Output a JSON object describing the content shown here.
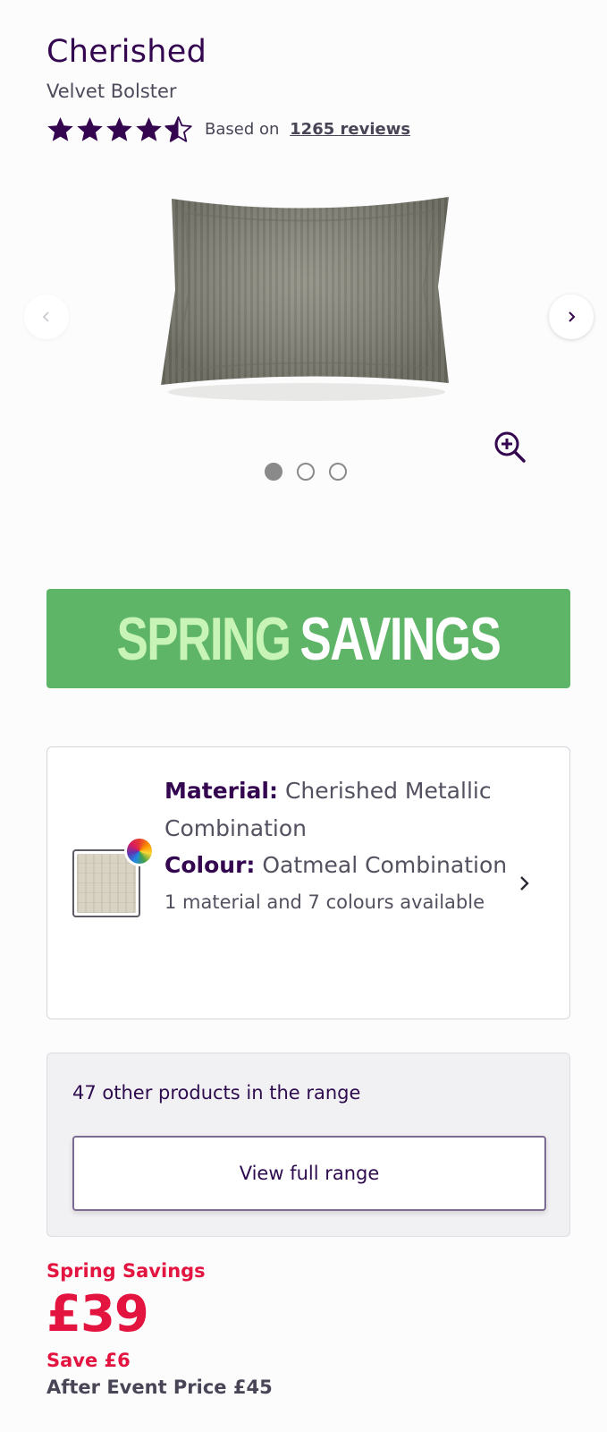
{
  "product": {
    "brand": "Cherished",
    "name": "Velvet Bolster"
  },
  "rating": {
    "stars": 4.5,
    "max_stars": 5,
    "prefix": "Based on",
    "reviews_link": "1265 reviews"
  },
  "gallery": {
    "image_count": 3,
    "active_index": 0
  },
  "banner": {
    "word1": "SPRING",
    "word2": "SAVINGS"
  },
  "selection": {
    "material_label": "Material:",
    "material_value": "Cherished Metallic Combination",
    "colour_label": "Colour:",
    "colour_value": "Oatmeal Combination",
    "availability": "1 material and 7 colours available"
  },
  "range": {
    "text": "47 other products in the range",
    "button_label": "View full range"
  },
  "pricing": {
    "promo_label": "Spring Savings",
    "price": "£39",
    "save": "Save £6",
    "after_event": "After Event Price £45"
  },
  "colors": {
    "brand_purple": "#33064f",
    "banner_green": "#5fb567",
    "sale_red": "#e3143f"
  },
  "icons": [
    "star-icon",
    "half-star-icon",
    "chevron-left-icon",
    "chevron-right-icon",
    "zoom-in-icon",
    "color-wheel-icon"
  ]
}
